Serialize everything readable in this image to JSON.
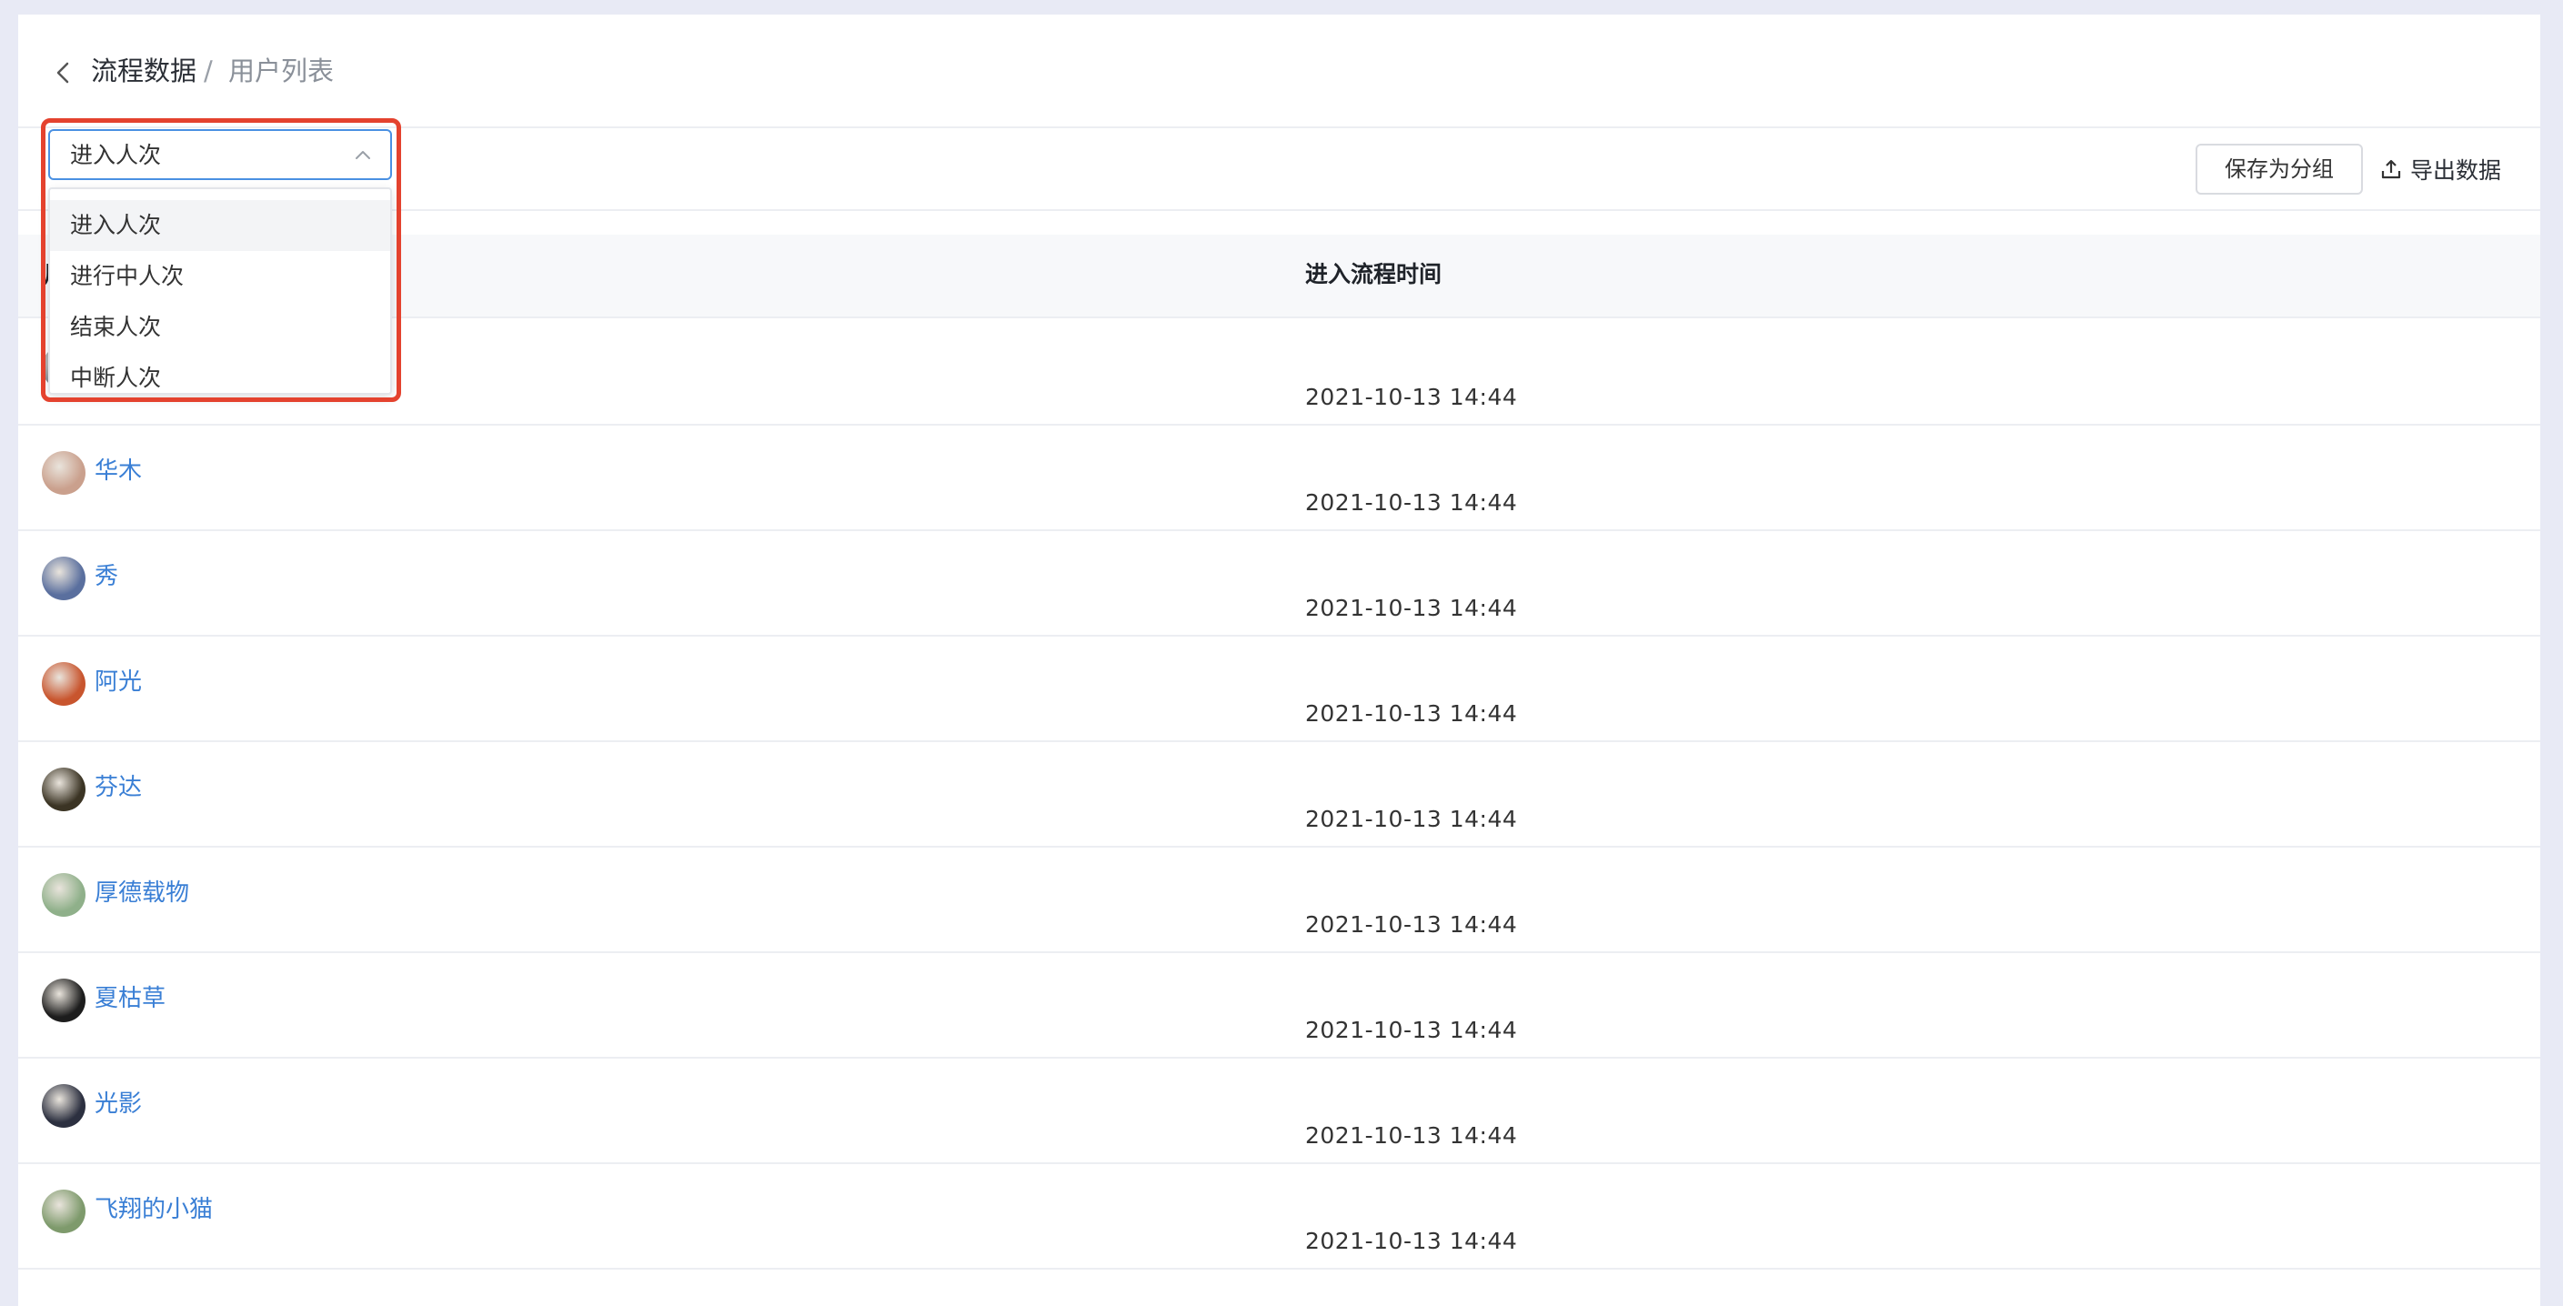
{
  "breadcrumb": {
    "current": "流程数据",
    "separator": "/",
    "page": "用户列表"
  },
  "select": {
    "value": "进入人次"
  },
  "dropdown": {
    "options": [
      "进入人次",
      "进行中人次",
      "结束人次",
      "中断人次"
    ]
  },
  "toolbar": {
    "save_label": "保存为分组",
    "export_label": "导出数据"
  },
  "table": {
    "columns": {
      "user": "用",
      "time": "进入流程时间"
    },
    "rows": [
      {
        "name": "",
        "time": "2021-10-13 14:44",
        "avatar_color": "#8a8f96"
      },
      {
        "name": "华木",
        "time": "2021-10-13 14:44",
        "avatar_color": "#caa08d"
      },
      {
        "name": "秀",
        "time": "2021-10-13 14:44",
        "avatar_color": "#5a6f9e"
      },
      {
        "name": "阿光",
        "time": "2021-10-13 14:44",
        "avatar_color": "#c8552e"
      },
      {
        "name": "芬达",
        "time": "2021-10-13 14:44",
        "avatar_color": "#3b3424"
      },
      {
        "name": "厚德载物",
        "time": "2021-10-13 14:44",
        "avatar_color": "#8fb08a"
      },
      {
        "name": "夏枯草",
        "time": "2021-10-13 14:44",
        "avatar_color": "#1d1d1d"
      },
      {
        "name": "光影",
        "time": "2021-10-13 14:44",
        "avatar_color": "#2c3040"
      },
      {
        "name": "飞翔的小猫",
        "time": "2021-10-13 14:44",
        "avatar_color": "#7e9a6c"
      }
    ]
  },
  "colors": {
    "link": "#3a7fd5",
    "focus": "#4a90e2",
    "highlight": "#e4422e"
  }
}
